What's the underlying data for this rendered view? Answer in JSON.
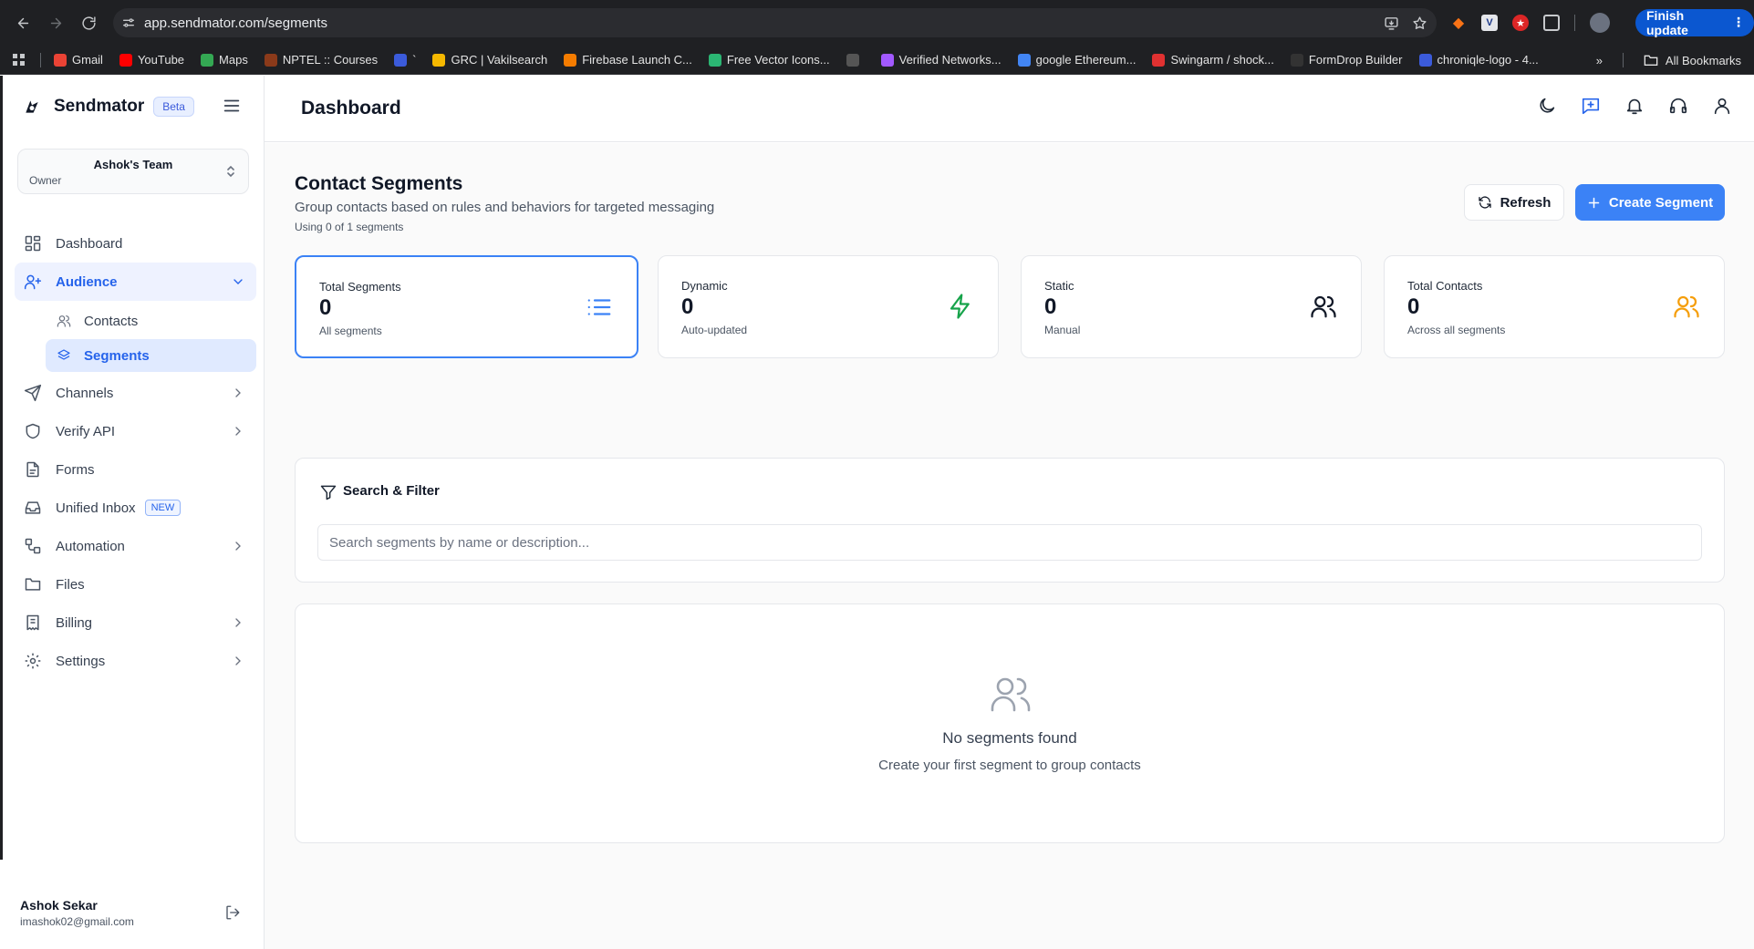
{
  "browser": {
    "url": "app.sendmator.com/segments",
    "update_button": "Finish update",
    "bookmarks": [
      {
        "label": "Gmail",
        "color": "#ea4335"
      },
      {
        "label": "YouTube",
        "color": "#ff0000"
      },
      {
        "label": "Maps",
        "color": "#34a853"
      },
      {
        "label": "NPTEL :: Courses",
        "color": "#8b3a1a"
      },
      {
        "label": "`",
        "color": "#3b5bdb"
      },
      {
        "label": "GRC | Vakilsearch",
        "color": "#f5b800"
      },
      {
        "label": "Firebase Launch C...",
        "color": "#f57c00"
      },
      {
        "label": "Free Vector Icons...",
        "color": "#2bb673"
      },
      {
        "label": "",
        "color": "#555555"
      },
      {
        "label": "Verified Networks...",
        "color": "#a259ff"
      },
      {
        "label": "google Ethereum...",
        "color": "#4285f4"
      },
      {
        "label": "Swingarm / shock...",
        "color": "#e03131"
      },
      {
        "label": "FormDrop Builder",
        "color": "#333333"
      },
      {
        "label": "chroniqle-logo - 4...",
        "color": "#3b5bdb"
      }
    ],
    "more_bookmarks": "»",
    "all_bookmarks": "All Bookmarks"
  },
  "sidebar": {
    "brand": "Sendmator",
    "beta": "Beta",
    "team": {
      "name": "Ashok's Team",
      "role": "Owner"
    },
    "nav": {
      "dashboard": "Dashboard",
      "audience": "Audience",
      "contacts": "Contacts",
      "segments": "Segments",
      "channels": "Channels",
      "verify_api": "Verify API",
      "forms": "Forms",
      "unified_inbox": "Unified Inbox",
      "new_badge": "NEW",
      "automation": "Automation",
      "files": "Files",
      "billing": "Billing",
      "settings": "Settings"
    },
    "user": {
      "name": "Ashok Sekar",
      "email": "imashok02@gmail.com"
    }
  },
  "header": {
    "title": "Dashboard"
  },
  "page": {
    "title": "Contact Segments",
    "subtitle": "Group contacts based on rules and behaviors for targeted messaging",
    "usage": "Using 0 of 1 segments",
    "refresh_label": "Refresh",
    "create_label": "Create Segment"
  },
  "stats": [
    {
      "label": "Total Segments",
      "value": "0",
      "desc": "All segments",
      "icon": "list-icon",
      "color": "#3b82f6"
    },
    {
      "label": "Dynamic",
      "value": "0",
      "desc": "Auto-updated",
      "icon": "lightning-icon",
      "color": "#16a34a"
    },
    {
      "label": "Static",
      "value": "0",
      "desc": "Manual",
      "icon": "users-icon",
      "color": "#111827"
    },
    {
      "label": "Total Contacts",
      "value": "0",
      "desc": "Across all segments",
      "icon": "users-icon",
      "color": "#f59e0b"
    }
  ],
  "filter": {
    "title": "Search & Filter",
    "placeholder": "Search segments by name or description..."
  },
  "empty": {
    "title": "No segments found",
    "subtitle": "Create your first segment to group contacts"
  },
  "colors": {
    "accent": "#3b82f6",
    "active_bg": "#eef2ff"
  }
}
